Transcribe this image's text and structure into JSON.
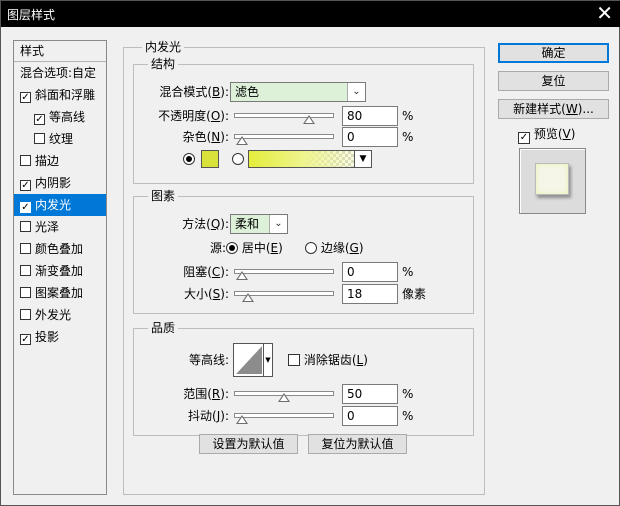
{
  "window": {
    "title": "图层样式",
    "close": "✕"
  },
  "sidebar": {
    "header": "样式",
    "items": [
      {
        "label": "混合选项:自定",
        "checkbox": false,
        "checked": false,
        "indent": false,
        "selected": false
      },
      {
        "label": "斜面和浮雕",
        "checkbox": true,
        "checked": true,
        "indent": false,
        "selected": false
      },
      {
        "label": "等高线",
        "checkbox": true,
        "checked": true,
        "indent": true,
        "selected": false
      },
      {
        "label": "纹理",
        "checkbox": true,
        "checked": false,
        "indent": true,
        "selected": false
      },
      {
        "label": "描边",
        "checkbox": true,
        "checked": false,
        "indent": false,
        "selected": false
      },
      {
        "label": "内阴影",
        "checkbox": true,
        "checked": true,
        "indent": false,
        "selected": false
      },
      {
        "label": "内发光",
        "checkbox": true,
        "checked": true,
        "indent": false,
        "selected": true
      },
      {
        "label": "光泽",
        "checkbox": true,
        "checked": false,
        "indent": false,
        "selected": false
      },
      {
        "label": "颜色叠加",
        "checkbox": true,
        "checked": false,
        "indent": false,
        "selected": false
      },
      {
        "label": "渐变叠加",
        "checkbox": true,
        "checked": false,
        "indent": false,
        "selected": false
      },
      {
        "label": "图案叠加",
        "checkbox": true,
        "checked": false,
        "indent": false,
        "selected": false
      },
      {
        "label": "外发光",
        "checkbox": true,
        "checked": false,
        "indent": false,
        "selected": false
      },
      {
        "label": "投影",
        "checkbox": true,
        "checked": true,
        "indent": false,
        "selected": false
      }
    ]
  },
  "inner_glow": {
    "title": "内发光",
    "structure": {
      "title": "结构",
      "blend_mode_label": "混合模式(",
      "blend_mode_key": "B",
      "blend_mode_value": "滤色",
      "opacity_label": "不透明度(",
      "opacity_key": "O",
      "opacity_value": "80",
      "opacity_fraction": 0.8,
      "noise_label": "杂色(",
      "noise_key": "N",
      "noise_value": "0",
      "noise_fraction": 0.0,
      "percent": "%",
      "swatch_color": "#d8e23a"
    },
    "elements": {
      "title": "图素",
      "method_label": "方法(",
      "method_key": "Q",
      "method_value": "柔和",
      "source_label": "源:",
      "center_label": "居中(",
      "center_key": "E",
      "edge_label": "边缘(",
      "edge_key": "G",
      "choke_label": "阻塞(",
      "choke_key": "C",
      "choke_value": "0",
      "choke_fraction": 0.0,
      "size_label": "大小(",
      "size_key": "S",
      "size_value": "18",
      "size_fraction": 0.07,
      "size_unit": "像素",
      "percent": "%"
    },
    "quality": {
      "title": "品质",
      "contour_label": "等高线:",
      "antialias_label": "消除锯齿(",
      "antialias_key": "L",
      "range_label": "范围(",
      "range_key": "R",
      "range_value": "50",
      "range_fraction": 0.5,
      "jitter_label": "抖动(",
      "jitter_key": "J",
      "jitter_value": "0",
      "jitter_fraction": 0.0,
      "percent": "%"
    },
    "make_default": "设置为默认值",
    "reset_default": "复位为默认值"
  },
  "buttons": {
    "ok": "确定",
    "reset": "复位",
    "new_style": "新建样式(",
    "new_style_key": "W",
    "new_style_tail": ")...",
    "preview_label": "预览(",
    "preview_key": "V"
  },
  "close_paren": ")",
  "colon_paren": "):"
}
